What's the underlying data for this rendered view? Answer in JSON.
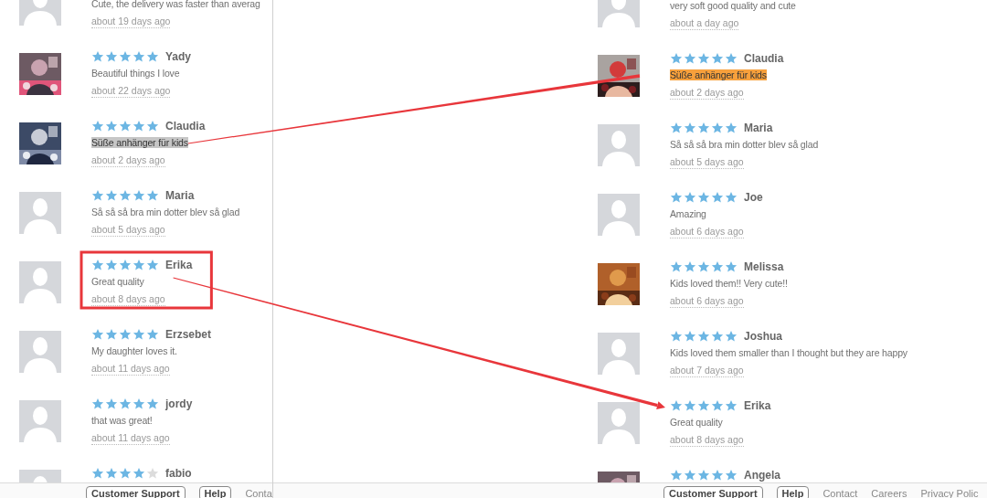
{
  "left": {
    "reviews": [
      {
        "photo": false,
        "comment": "Cute, the delivery was faster than averag",
        "time": "about 19 days ago"
      },
      {
        "photo": true,
        "stars": 5,
        "name": "Yady",
        "comment": "Beautiful things I love",
        "time": "about 22 days ago"
      },
      {
        "photo": true,
        "stars": 5,
        "name": "Claudia",
        "comment": "Süße anhänger für kids",
        "color": "#c6c6c6",
        "arrow_from": true,
        "time": "about 2 days ago"
      },
      {
        "photo": false,
        "stars": 5,
        "name": "Maria",
        "comment": "Så så så bra min dotter blev så glad",
        "time": "about 5 days ago"
      },
      {
        "photo": false,
        "stars": 5,
        "name": "Erika",
        "comment": "Great quality",
        "boxed": true,
        "arrow_from": true,
        "time": "about 8 days ago"
      },
      {
        "photo": false,
        "stars": 5,
        "name": "Erzsebet",
        "comment": "My daughter loves it.",
        "time": "about 11 days ago"
      },
      {
        "photo": false,
        "stars": 5,
        "name": "jordy",
        "comment": "that was great!",
        "time": "about 11 days ago"
      },
      {
        "photo": false,
        "stars": 4,
        "name": "fabio"
      }
    ],
    "footer": {
      "buttons": [
        "Customer Support",
        "Help"
      ],
      "links": [
        "Conta"
      ]
    }
  },
  "right": {
    "reviews": [
      {
        "photo": false,
        "comment": "very soft good quality and cute",
        "time": "about a day ago"
      },
      {
        "photo": true,
        "stars": 5,
        "name": "Claudia",
        "comment": "Süße anhänger für kids",
        "color": "#f7a03c",
        "arrow_to": true,
        "time": "about 2 days ago"
      },
      {
        "photo": false,
        "stars": 5,
        "name": "Maria",
        "comment": "Så så så bra min dotter blev så glad",
        "time": "about 5 days ago"
      },
      {
        "photo": false,
        "stars": 5,
        "name": "Joe",
        "comment": "Amazing",
        "time": "about 6 days ago"
      },
      {
        "photo": true,
        "stars": 5,
        "name": "Melissa",
        "comment": "Kids loved them!! Very cute!!",
        "time": "about 6 days ago"
      },
      {
        "photo": false,
        "stars": 5,
        "name": "Joshua",
        "comment": "Kids loved them smaller than I thought but they are happy",
        "time": "about 7 days ago"
      },
      {
        "photo": false,
        "stars": 5,
        "name": "Erika",
        "comment": "Great quality",
        "arrow_to": true,
        "time": "about 8 days ago"
      },
      {
        "photo": true,
        "stars": 5,
        "name": "Angela"
      }
    ],
    "footer": {
      "buttons": [
        "Customer Support",
        "Help"
      ],
      "links": [
        "Contact",
        "Careers",
        "Privacy Polic"
      ]
    }
  },
  "arrows": [
    {
      "head": false
    },
    {
      "head": true
    }
  ]
}
